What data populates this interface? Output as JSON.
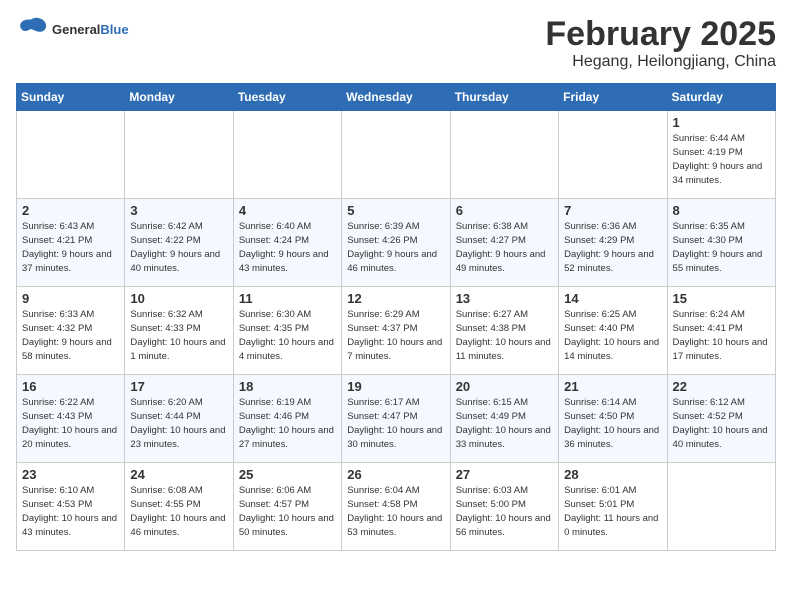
{
  "logo": {
    "general": "General",
    "blue": "Blue"
  },
  "title": "February 2025",
  "subtitle": "Hegang, Heilongjiang, China",
  "days_of_week": [
    "Sunday",
    "Monday",
    "Tuesday",
    "Wednesday",
    "Thursday",
    "Friday",
    "Saturday"
  ],
  "weeks": [
    [
      {
        "day": "",
        "info": ""
      },
      {
        "day": "",
        "info": ""
      },
      {
        "day": "",
        "info": ""
      },
      {
        "day": "",
        "info": ""
      },
      {
        "day": "",
        "info": ""
      },
      {
        "day": "",
        "info": ""
      },
      {
        "day": "1",
        "info": "Sunrise: 6:44 AM\nSunset: 4:19 PM\nDaylight: 9 hours and 34 minutes."
      }
    ],
    [
      {
        "day": "2",
        "info": "Sunrise: 6:43 AM\nSunset: 4:21 PM\nDaylight: 9 hours and 37 minutes."
      },
      {
        "day": "3",
        "info": "Sunrise: 6:42 AM\nSunset: 4:22 PM\nDaylight: 9 hours and 40 minutes."
      },
      {
        "day": "4",
        "info": "Sunrise: 6:40 AM\nSunset: 4:24 PM\nDaylight: 9 hours and 43 minutes."
      },
      {
        "day": "5",
        "info": "Sunrise: 6:39 AM\nSunset: 4:26 PM\nDaylight: 9 hours and 46 minutes."
      },
      {
        "day": "6",
        "info": "Sunrise: 6:38 AM\nSunset: 4:27 PM\nDaylight: 9 hours and 49 minutes."
      },
      {
        "day": "7",
        "info": "Sunrise: 6:36 AM\nSunset: 4:29 PM\nDaylight: 9 hours and 52 minutes."
      },
      {
        "day": "8",
        "info": "Sunrise: 6:35 AM\nSunset: 4:30 PM\nDaylight: 9 hours and 55 minutes."
      }
    ],
    [
      {
        "day": "9",
        "info": "Sunrise: 6:33 AM\nSunset: 4:32 PM\nDaylight: 9 hours and 58 minutes."
      },
      {
        "day": "10",
        "info": "Sunrise: 6:32 AM\nSunset: 4:33 PM\nDaylight: 10 hours and 1 minute."
      },
      {
        "day": "11",
        "info": "Sunrise: 6:30 AM\nSunset: 4:35 PM\nDaylight: 10 hours and 4 minutes."
      },
      {
        "day": "12",
        "info": "Sunrise: 6:29 AM\nSunset: 4:37 PM\nDaylight: 10 hours and 7 minutes."
      },
      {
        "day": "13",
        "info": "Sunrise: 6:27 AM\nSunset: 4:38 PM\nDaylight: 10 hours and 11 minutes."
      },
      {
        "day": "14",
        "info": "Sunrise: 6:25 AM\nSunset: 4:40 PM\nDaylight: 10 hours and 14 minutes."
      },
      {
        "day": "15",
        "info": "Sunrise: 6:24 AM\nSunset: 4:41 PM\nDaylight: 10 hours and 17 minutes."
      }
    ],
    [
      {
        "day": "16",
        "info": "Sunrise: 6:22 AM\nSunset: 4:43 PM\nDaylight: 10 hours and 20 minutes."
      },
      {
        "day": "17",
        "info": "Sunrise: 6:20 AM\nSunset: 4:44 PM\nDaylight: 10 hours and 23 minutes."
      },
      {
        "day": "18",
        "info": "Sunrise: 6:19 AM\nSunset: 4:46 PM\nDaylight: 10 hours and 27 minutes."
      },
      {
        "day": "19",
        "info": "Sunrise: 6:17 AM\nSunset: 4:47 PM\nDaylight: 10 hours and 30 minutes."
      },
      {
        "day": "20",
        "info": "Sunrise: 6:15 AM\nSunset: 4:49 PM\nDaylight: 10 hours and 33 minutes."
      },
      {
        "day": "21",
        "info": "Sunrise: 6:14 AM\nSunset: 4:50 PM\nDaylight: 10 hours and 36 minutes."
      },
      {
        "day": "22",
        "info": "Sunrise: 6:12 AM\nSunset: 4:52 PM\nDaylight: 10 hours and 40 minutes."
      }
    ],
    [
      {
        "day": "23",
        "info": "Sunrise: 6:10 AM\nSunset: 4:53 PM\nDaylight: 10 hours and 43 minutes."
      },
      {
        "day": "24",
        "info": "Sunrise: 6:08 AM\nSunset: 4:55 PM\nDaylight: 10 hours and 46 minutes."
      },
      {
        "day": "25",
        "info": "Sunrise: 6:06 AM\nSunset: 4:57 PM\nDaylight: 10 hours and 50 minutes."
      },
      {
        "day": "26",
        "info": "Sunrise: 6:04 AM\nSunset: 4:58 PM\nDaylight: 10 hours and 53 minutes."
      },
      {
        "day": "27",
        "info": "Sunrise: 6:03 AM\nSunset: 5:00 PM\nDaylight: 10 hours and 56 minutes."
      },
      {
        "day": "28",
        "info": "Sunrise: 6:01 AM\nSunset: 5:01 PM\nDaylight: 11 hours and 0 minutes."
      },
      {
        "day": "",
        "info": ""
      }
    ]
  ]
}
